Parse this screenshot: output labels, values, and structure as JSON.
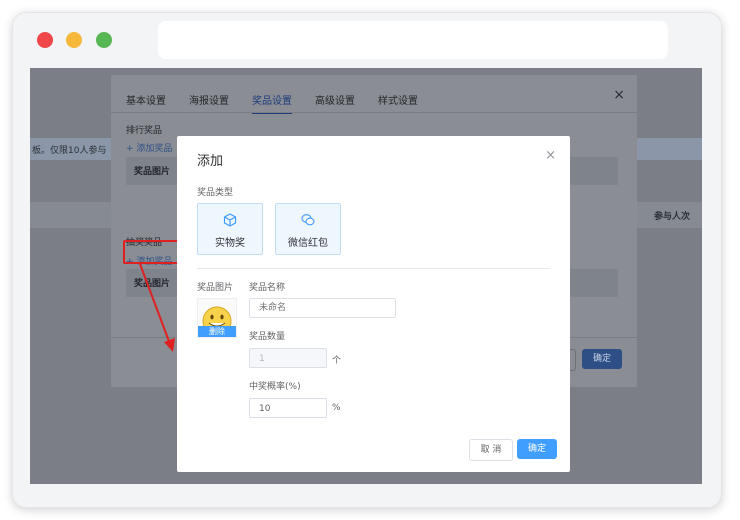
{
  "browser": {
    "dots": [
      "#f0464a",
      "#f6b73c",
      "#57b853"
    ]
  },
  "background_page": {
    "banner_text": "板。仅限10人参与",
    "column_header": "参与人次"
  },
  "settings_dialog": {
    "tabs": [
      {
        "label": "基本设置",
        "active": false
      },
      {
        "label": "海报设置",
        "active": false
      },
      {
        "label": "奖品设置",
        "active": true
      },
      {
        "label": "高级设置",
        "active": false
      },
      {
        "label": "样式设置",
        "active": false
      }
    ],
    "close_glyph": "×",
    "ranking_section_title": "排行奖品",
    "ranking_add_link": "+ 添加奖品",
    "ranking_table_header": "奖品图片",
    "lottery_section_title": "抽奖奖品",
    "lottery_add_link": "+ 添加奖品",
    "lottery_table_header": "奖品图片",
    "confirm_label": "确定"
  },
  "add_modal": {
    "title": "添加",
    "close_glyph": "×",
    "prize_type_label": "奖品类型",
    "prize_types": [
      {
        "label": "实物奖",
        "icon": "box-icon"
      },
      {
        "label": "微信红包",
        "icon": "wechat-icon"
      }
    ],
    "image_label": "奖品图片",
    "delete_label": "删除",
    "name_label": "奖品名称",
    "name_placeholder": "未命名",
    "quantity_label": "奖品数量",
    "quantity_value": "1",
    "quantity_unit": "个",
    "probability_label": "中奖概率(%)",
    "probability_value": "10",
    "probability_unit": "%",
    "cancel_label": "取 消",
    "confirm_label": "确定"
  },
  "colors": {
    "primary": "#409eff",
    "annotation_red": "#e02020"
  }
}
